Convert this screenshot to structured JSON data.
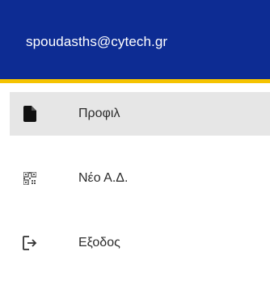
{
  "header": {
    "email": "spoudasths@cytech.gr",
    "background_color": "#0d2c93",
    "accent_color": "#f5c300"
  },
  "menu": {
    "items": [
      {
        "label": "Προφιλ",
        "icon": "document-icon",
        "active": true
      },
      {
        "label": "Νέο Α.Δ.",
        "icon": "qr-code-icon",
        "active": false
      },
      {
        "label": "Εξοδος",
        "icon": "logout-icon",
        "active": false
      }
    ]
  }
}
